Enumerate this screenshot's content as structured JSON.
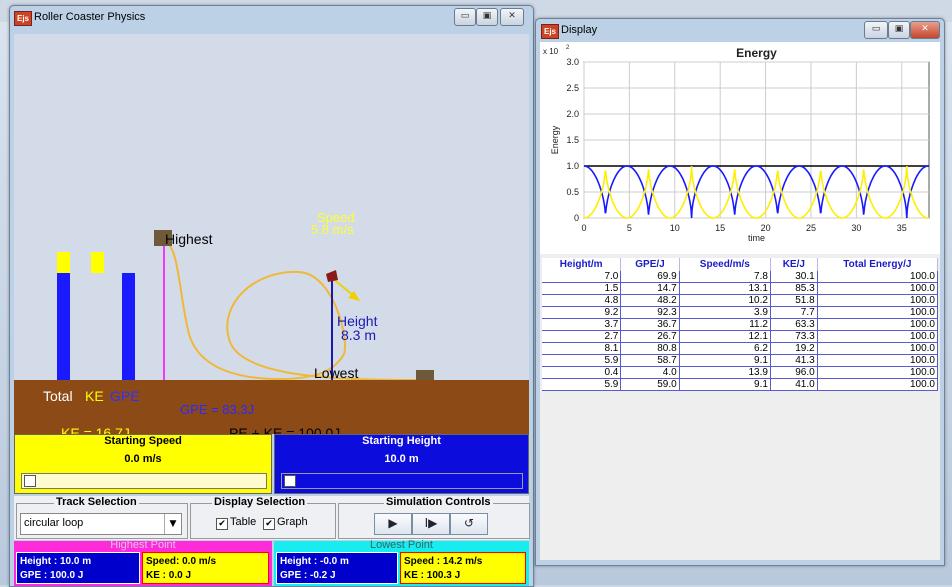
{
  "left_window": {
    "title": "Roller Coaster Physics",
    "icon": "Ejs"
  },
  "sim": {
    "highest_label": "Highest",
    "lowest_label": "Lowest",
    "speed_label": "Speed",
    "speed_value": "5.8 m/s",
    "height_label": "Height",
    "height_value": "8.3 m",
    "total_label": "Total",
    "ke_label": "KE",
    "gpe_label": "GPE",
    "gpe_readout": "GPE = 83.3J",
    "ke_readout": "KE = 16.7J",
    "sum_readout": "PE + KE = 100.0J",
    "bar_ke_fraction": 0.167,
    "bar_gpe_fraction": 0.833
  },
  "controls": {
    "starting_speed_label": "Starting Speed",
    "starting_speed_value": "0.0 m/s",
    "starting_height_label": "Starting Height",
    "starting_height_value": "10.0 m",
    "track_selection_label": "Track Selection",
    "track_value": "circular loop",
    "display_selection_label": "Display Selection",
    "table_label": "Table",
    "graph_label": "Graph",
    "sim_controls_label": "Simulation Controls",
    "play_icon": "▶",
    "step_icon": "I▶",
    "reset_icon": "↺"
  },
  "highest_point": {
    "label": "Highest Point",
    "height": "Height : 10.0 m",
    "gpe": "GPE : 100.0 J",
    "speed": "Speed: 0.0 m/s",
    "ke": "KE : 0.0 J"
  },
  "lowest_point": {
    "label": "Lowest Point",
    "height": "Height : -0.0 m",
    "gpe": "GPE : -0.2 J",
    "speed": "Speed : 14.2 m/s",
    "ke": "KE : 100.3 J"
  },
  "right_window": {
    "title": "Display",
    "icon": "Ejs"
  },
  "chart_data": {
    "type": "line",
    "title": "Energy",
    "xlabel": "time",
    "ylabel": "Energy",
    "y_multiplier": "x 10",
    "y_multiplier_exp": "2",
    "xlim": [
      0,
      38
    ],
    "ylim": [
      0,
      3.0
    ],
    "xticks": [
      0,
      5,
      10,
      15,
      20,
      25,
      30,
      35
    ],
    "yticks": [
      0,
      0.5,
      1.0,
      1.5,
      2.0,
      2.5,
      3.0
    ],
    "ytick_labels": [
      "0",
      "0.5",
      "1.0",
      "1.5",
      "2.0",
      "2.5",
      "3.0"
    ],
    "grid": true,
    "period": 4.74,
    "series": [
      {
        "color": "#000000",
        "kind": "total",
        "values": [
          [
            0,
            1.0
          ],
          [
            38,
            1.0
          ]
        ]
      },
      {
        "color": "#1a1aff",
        "kind": "gpe",
        "phase": 0
      },
      {
        "color": "#ffee00",
        "kind": "ke",
        "phase": 0
      }
    ]
  },
  "table": {
    "headers": [
      "Height/m",
      "GPE/J",
      "Speed/m/s",
      "KE/J",
      "Total Energy/J"
    ],
    "rows": [
      [
        "7.0",
        "69.9",
        "7.8",
        "30.1",
        "100.0"
      ],
      [
        "1.5",
        "14.7",
        "13.1",
        "85.3",
        "100.0"
      ],
      [
        "4.8",
        "48.2",
        "10.2",
        "51.8",
        "100.0"
      ],
      [
        "9.2",
        "92.3",
        "3.9",
        "7.7",
        "100.0"
      ],
      [
        "3.7",
        "36.7",
        "11.2",
        "63.3",
        "100.0"
      ],
      [
        "2.7",
        "26.7",
        "12.1",
        "73.3",
        "100.0"
      ],
      [
        "8.1",
        "80.8",
        "6.2",
        "19.2",
        "100.0"
      ],
      [
        "5.9",
        "58.7",
        "9.1",
        "41.3",
        "100.0"
      ],
      [
        "0.4",
        "4.0",
        "13.9",
        "96.0",
        "100.0"
      ],
      [
        "5.9",
        "59.0",
        "9.1",
        "41.0",
        "100.0"
      ]
    ]
  },
  "colors": {
    "ke": "#ffff00",
    "gpe": "#1a1aff",
    "ground": "#8c4a16",
    "highest": "#ff00ff",
    "lowest": "#00ffff"
  }
}
